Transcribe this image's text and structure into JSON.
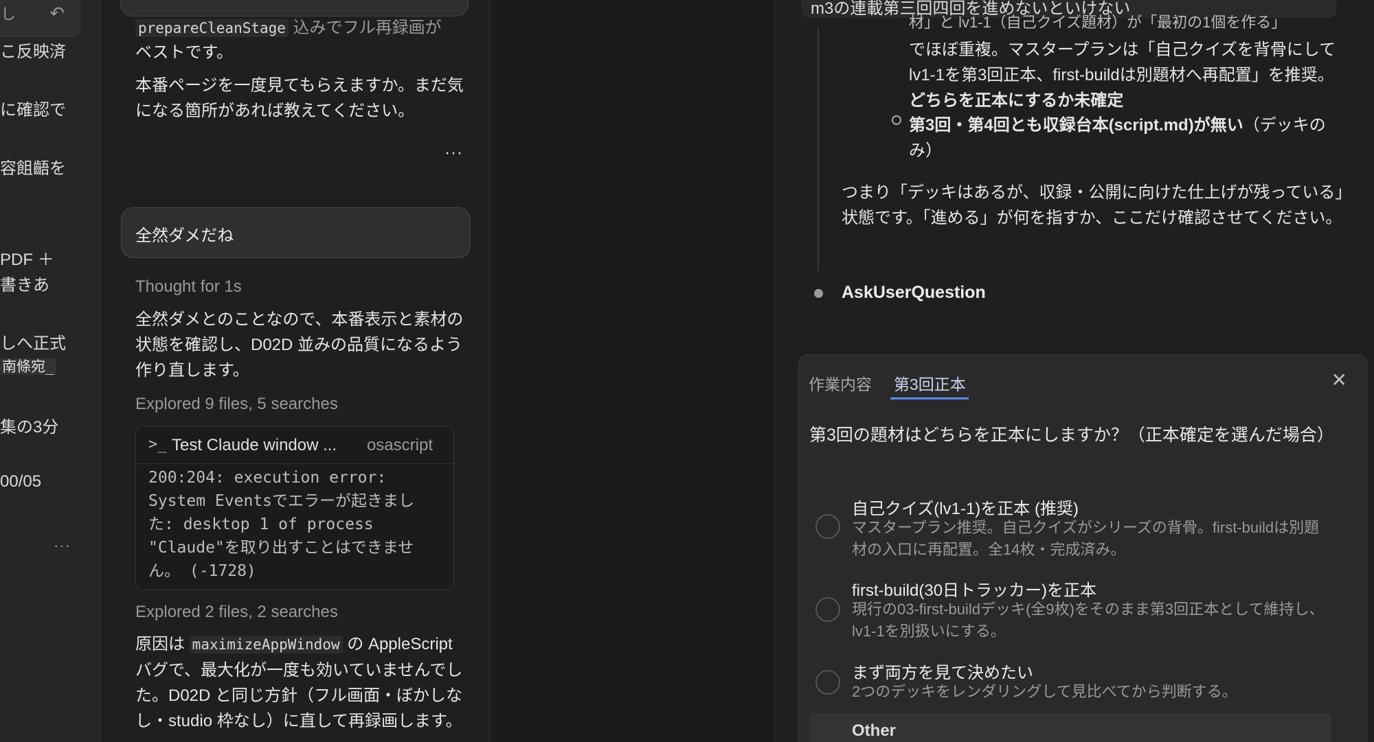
{
  "left": {
    "undo_fragment": "し",
    "lines": [
      "こ反映済",
      "に確認で",
      "容飷齬を",
      "PDF ＋",
      "書きあ",
      "しへ正式",
      "南條宛_",
      "集の3分",
      "00/05"
    ],
    "dots": "···"
  },
  "chat": {
    "p1_code": "prepareCleanStage",
    "p1_rest": " 込みでフル再録画が",
    "p1_line2": "ベストです。",
    "p2": "本番ページを一度見てもらえますか。まだ気になる箇所があれば教えてください。",
    "dots": "···",
    "user_message": "全然ダメだね",
    "thought": "Thought for 1s",
    "reply": "全然ダメとのことなので、本番表示と素材の状態を確認し、D02D 並みの品質になるよう作り直します。",
    "explored1": "Explored 9 files, 5 searches",
    "tool": {
      "prompt": ">_",
      "title": "Test Claude window ...",
      "kind": "osascript",
      "output": "200:204: execution error:\nSystem Eventsでエラーが起きまし\nた: desktop 1 of process\n\"Claude\"を取り出すことはできませ\nん。 (-1728)"
    },
    "explored2": "Explored 2 files, 2 searches",
    "p3_a": "原因は ",
    "p3_code": "maximizeAppWindow",
    "p3_b": " の AppleScript バグで、最大化が一度も効いていませんでした。D02D と同じ方針（フル画面・ぼかしなし・studio 枠なし）に直して再録画します。"
  },
  "right": {
    "top_text": "m3の連載第三回四回を進めないといけない",
    "frag_line": "材」と lv1-1（自己クイズ題材）が「最初の1個を作る」",
    "para_a": "でほぼ重複。マスタープランは「自己クイズを背骨にしてlv1-1を第3回正本、first-buildは別題材へ再配置」を推奨。",
    "para_a_bold": "どちらを正本にするか未確定",
    "bullet_bold": "第3回・第4回とも収録台本(script.md)が無い",
    "bullet_rest": "（デッキのみ）",
    "summary": "つまり「デッキはあるが、収録・公開に向けた仕上げが残っている」状態です。「進める」が何を指すか、ここだけ確認させてください。",
    "ask_label": "AskUserQuestion",
    "question_panel": {
      "tabs": [
        "作業内容",
        "第3回正本"
      ],
      "active_tab": 1,
      "close": "✕",
      "question": "第3回の題材はどちらを正本にしますか？（正本確定を選んだ場合）",
      "options": [
        {
          "title": "自己クイズ(lv1-1)を正本 (推奨)",
          "desc": "マスタープラン推奨。自己クイズがシリーズの背骨。first-buildは別題材の入口に再配置。全14枚・完成済み。"
        },
        {
          "title": "first-build(30日トラッカー)を正本",
          "desc": "現行の03-first-buildデッキ(全9枚)をそのまま第3回正本として維持し、lv1-1を別扱いにする。"
        },
        {
          "title": "まず両方を見て決めたい",
          "desc": "2つのデッキをレンダリングして見比べてから判断する。"
        }
      ],
      "other": "Other"
    }
  }
}
